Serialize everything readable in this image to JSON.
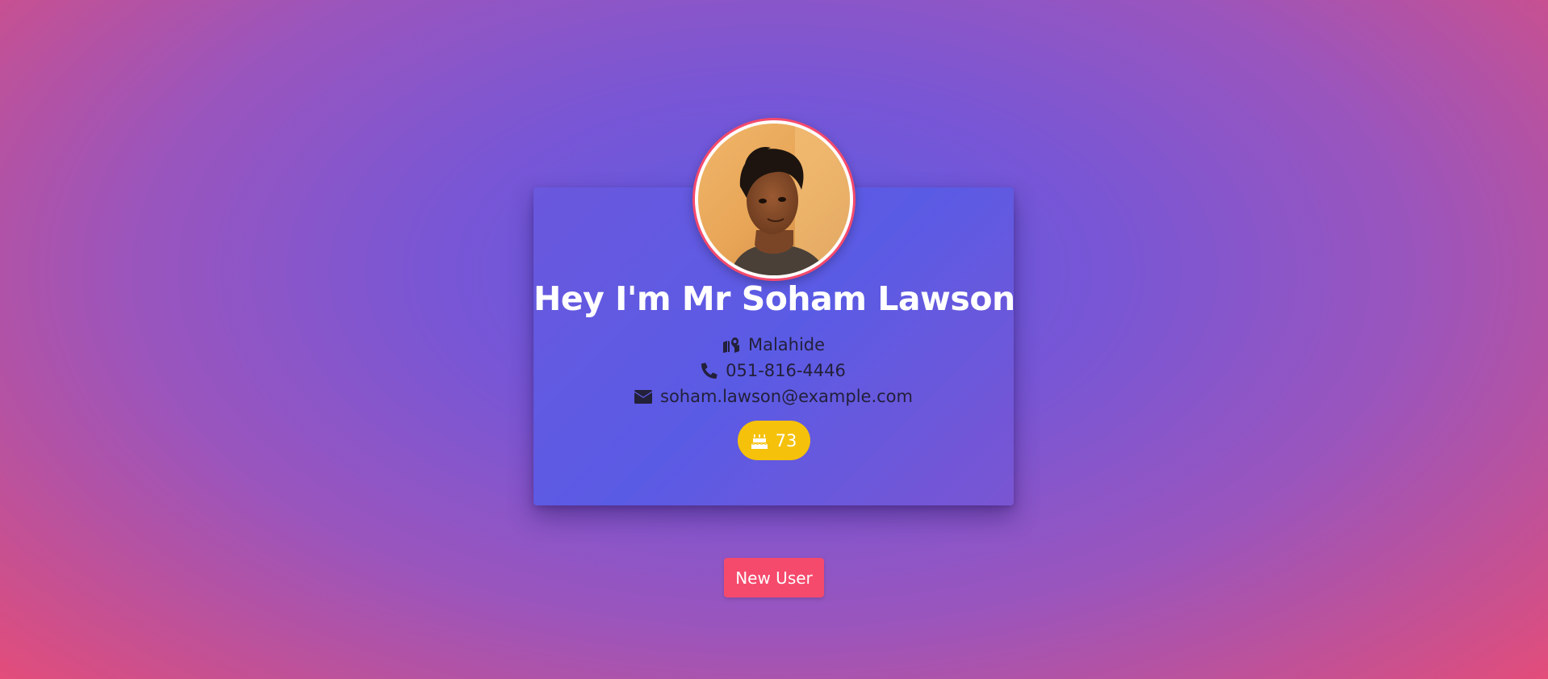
{
  "profile": {
    "greeting": "Hey I'm Mr Soham Lawson",
    "location": "Malahide",
    "phone": "051-816-4446",
    "email": "soham.lawson@example.com",
    "age": "73",
    "icons": {
      "location": "map-marked-icon",
      "phone": "phone-icon",
      "email": "envelope-icon",
      "age": "birthday-cake-icon"
    }
  },
  "actions": {
    "new_user_label": "New User"
  },
  "colors": {
    "accent": "#f54a6c",
    "badge": "#f5c10b",
    "card": "#5a5be5",
    "text_dark": "#23203a"
  }
}
